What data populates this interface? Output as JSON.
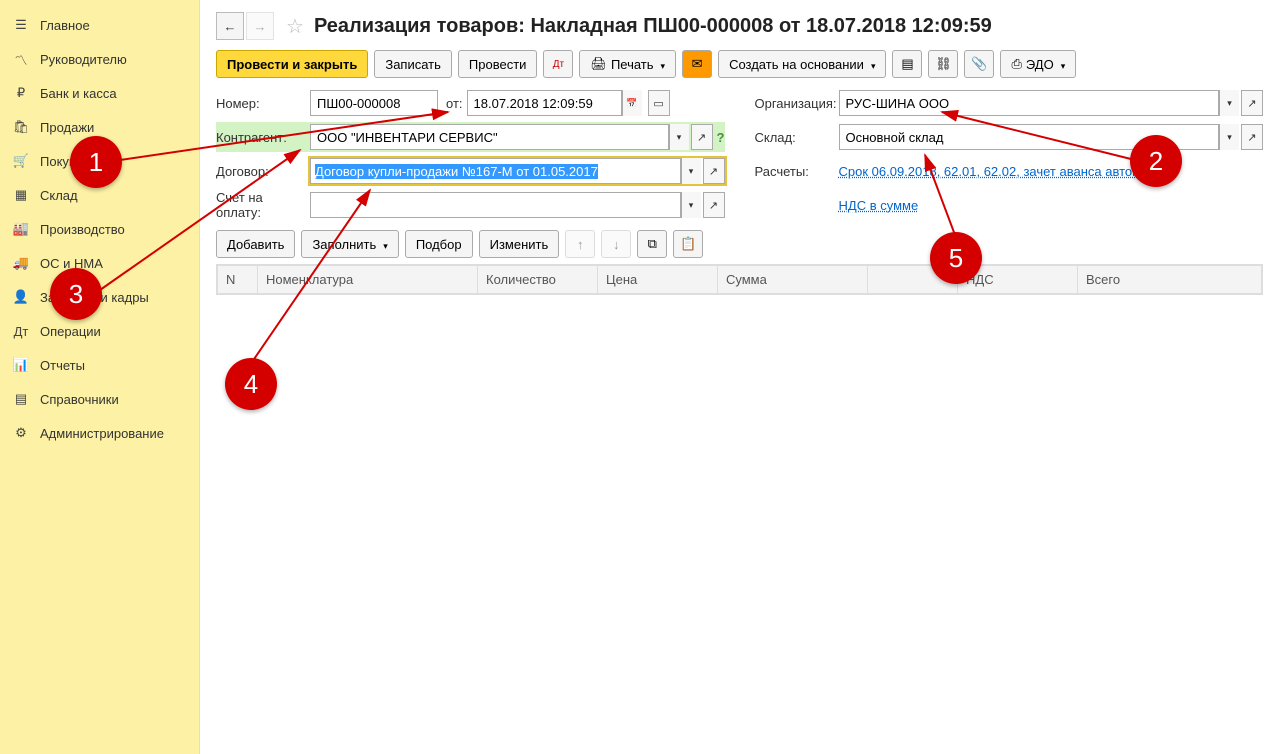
{
  "sidebar": {
    "items": [
      {
        "label": "Главное",
        "icon": "menu"
      },
      {
        "label": "Руководителю",
        "icon": "trend"
      },
      {
        "label": "Банк и касса",
        "icon": "ruble"
      },
      {
        "label": "Продажи",
        "icon": "bag"
      },
      {
        "label": "Покупки",
        "icon": "cart"
      },
      {
        "label": "Склад",
        "icon": "boxes"
      },
      {
        "label": "Производство",
        "icon": "factory"
      },
      {
        "label": "ОС и НМА",
        "icon": "truck"
      },
      {
        "label": "Зарплата и кадры",
        "icon": "person"
      },
      {
        "label": "Операции",
        "icon": "ops"
      },
      {
        "label": "Отчеты",
        "icon": "chart"
      },
      {
        "label": "Справочники",
        "icon": "book"
      },
      {
        "label": "Администрирование",
        "icon": "gear"
      }
    ]
  },
  "header": {
    "title": "Реализация товаров: Накладная ПШ00-000008 от 18.07.2018 12:09:59"
  },
  "toolbar": {
    "post_close": "Провести и закрыть",
    "save": "Записать",
    "post": "Провести",
    "print": "Печать",
    "create_based": "Создать на основании",
    "edo": "ЭДО"
  },
  "form": {
    "number_label": "Номер:",
    "number_value": "ПШ00-000008",
    "from_label": "от:",
    "date_value": "18.07.2018 12:09:59",
    "org_label": "Организация:",
    "org_value": "РУС-ШИНА ООО",
    "counterparty_label": "Контрагент:",
    "counterparty_value": "ООО \"ИНВЕНТАРИ СЕРВИС\"",
    "warehouse_label": "Склад:",
    "warehouse_value": "Основной склад",
    "contract_label": "Договор:",
    "contract_value": "Договор купли-продажи №167-М от 01.05.2017",
    "calc_label": "Расчеты:",
    "calc_link": "Срок 06.09.2018, 62.01, 62.02, зачет аванса автомат",
    "invoice_label": "Счет на оплату:",
    "vat_link": "НДС в сумме"
  },
  "items_toolbar": {
    "add": "Добавить",
    "fill": "Заполнить",
    "select": "Подбор",
    "change": "Изменить"
  },
  "table": {
    "columns": [
      "N",
      "Номенклатура",
      "Количество",
      "Цена",
      "Сумма",
      "",
      "НДС",
      "Всего"
    ]
  },
  "callouts": {
    "c1": "1",
    "c2": "2",
    "c3": "3",
    "c4": "4",
    "c5": "5"
  }
}
